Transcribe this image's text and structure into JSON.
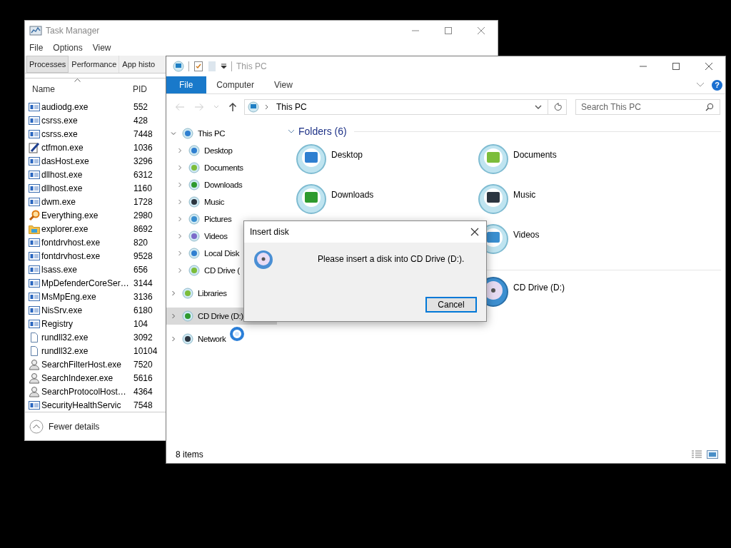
{
  "task_manager": {
    "title": "Task Manager",
    "menu": [
      "File",
      "Options",
      "View"
    ],
    "tabs": [
      {
        "label": "Processes",
        "selected": true
      },
      {
        "label": "Performance",
        "selected": false
      },
      {
        "label": "App histo",
        "selected": false
      }
    ],
    "columns": [
      "Name",
      "PID"
    ],
    "rows": [
      {
        "kind": "app",
        "name": "audiodg.exe",
        "pid": "552"
      },
      {
        "kind": "app",
        "name": "csrss.exe",
        "pid": "428"
      },
      {
        "kind": "app",
        "name": "csrss.exe",
        "pid": "7448"
      },
      {
        "kind": "pen",
        "name": "ctfmon.exe",
        "pid": "1036"
      },
      {
        "kind": "app",
        "name": "dasHost.exe",
        "pid": "3296"
      },
      {
        "kind": "app",
        "name": "dllhost.exe",
        "pid": "6312"
      },
      {
        "kind": "app",
        "name": "dllhost.exe",
        "pid": "1160"
      },
      {
        "kind": "app",
        "name": "dwm.exe",
        "pid": "1728"
      },
      {
        "kind": "magnifier",
        "name": "Everything.exe",
        "pid": "2980"
      },
      {
        "kind": "folder",
        "name": "explorer.exe",
        "pid": "8692"
      },
      {
        "kind": "app",
        "name": "fontdrvhost.exe",
        "pid": "820"
      },
      {
        "kind": "app",
        "name": "fontdrvhost.exe",
        "pid": "9528"
      },
      {
        "kind": "app",
        "name": "lsass.exe",
        "pid": "656"
      },
      {
        "kind": "app",
        "name": "MpDefenderCoreSer…",
        "pid": "3144"
      },
      {
        "kind": "app",
        "name": "MsMpEng.exe",
        "pid": "3136"
      },
      {
        "kind": "app",
        "name": "NisSrv.exe",
        "pid": "6180"
      },
      {
        "kind": "app",
        "name": "Registry",
        "pid": "104"
      },
      {
        "kind": "file",
        "name": "rundll32.exe",
        "pid": "3092"
      },
      {
        "kind": "file",
        "name": "rundll32.exe",
        "pid": "10104"
      },
      {
        "kind": "user",
        "name": "SearchFilterHost.exe",
        "pid": "7520"
      },
      {
        "kind": "user",
        "name": "SearchIndexer.exe",
        "pid": "5616"
      },
      {
        "kind": "user",
        "name": "SearchProtocolHost…",
        "pid": "4364"
      },
      {
        "kind": "app",
        "name": "SecurityHealthServic",
        "pid": "7548"
      }
    ],
    "footer": "Fewer details"
  },
  "explorer": {
    "title": "This PC",
    "ribbon_tabs": [
      {
        "label": "File",
        "selected": true
      },
      {
        "label": "Computer",
        "selected": false
      },
      {
        "label": "View",
        "selected": false
      }
    ],
    "help": "?",
    "address": "This PC",
    "search": {
      "placeholder": "Search This PC"
    },
    "nav": [
      {
        "label": "This PC",
        "expanded": true,
        "selected": false,
        "children": [
          {
            "label": "Desktop",
            "expanded": false,
            "selected": false
          },
          {
            "label": "Documents",
            "expanded": false,
            "selected": false
          },
          {
            "label": "Downloads",
            "expanded": false,
            "selected": false
          },
          {
            "label": "Music",
            "expanded": false,
            "selected": false
          },
          {
            "label": "Pictures",
            "expanded": false,
            "selected": false
          },
          {
            "label": "Videos",
            "expanded": false,
            "selected": false
          },
          {
            "label": "Local Disk",
            "expanded": false,
            "selected": false
          },
          {
            "label": "CD Drive (",
            "expanded": false,
            "selected": false
          }
        ]
      },
      {
        "label": "Libraries",
        "expanded": false,
        "selected": false
      },
      {
        "label": "CD Drive (D:)",
        "expanded": false,
        "selected": true
      },
      {
        "label": "Network",
        "expanded": false,
        "selected": false
      }
    ],
    "folders": {
      "title": "Folders (6)",
      "expanded": true,
      "items": [
        "Desktop",
        "Documents",
        "Downloads",
        "Music",
        "Videos"
      ]
    },
    "drives": {
      "items": [
        "CD Drive (D:)"
      ]
    },
    "status": "8 items"
  },
  "dialog": {
    "title": "Insert disk",
    "message": "Please insert a disk into CD Drive (D:).",
    "buttons": [
      {
        "label": "Cancel",
        "focused": true
      }
    ]
  }
}
